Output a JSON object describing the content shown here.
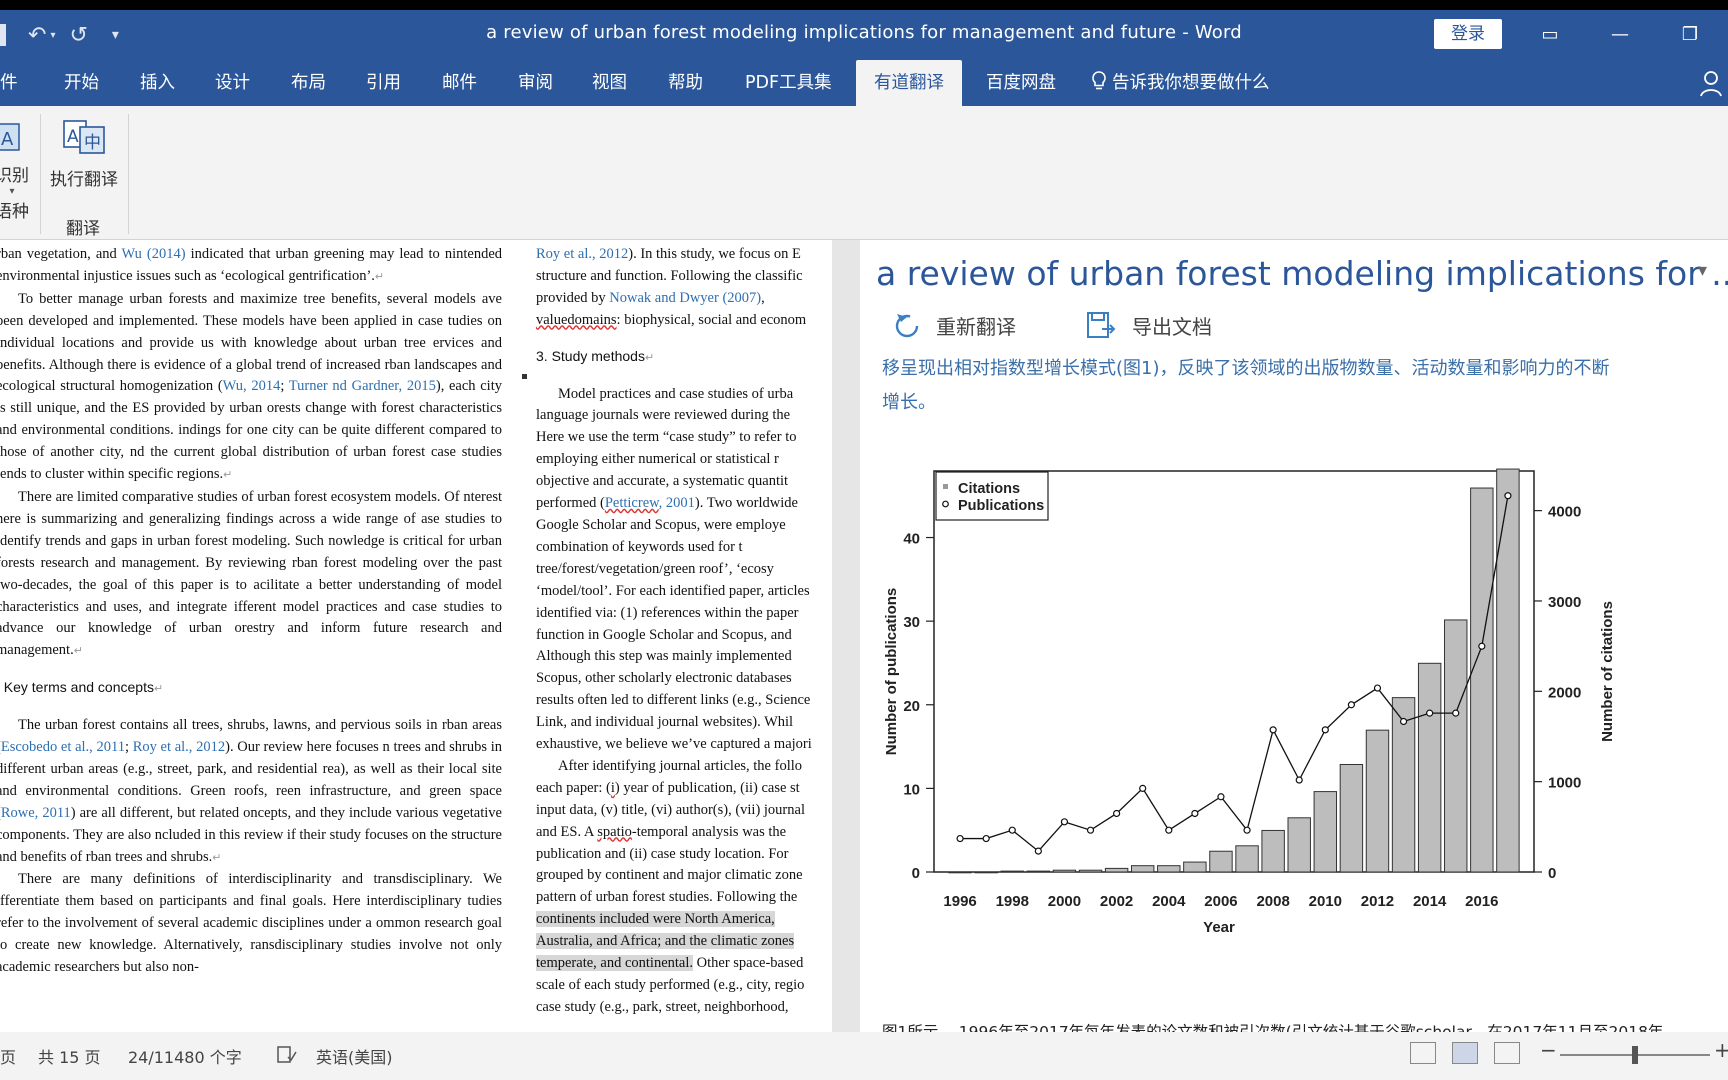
{
  "window": {
    "title": "a review of urban forest modeling implications for management and future  -  Word",
    "login": "登录",
    "restore_glyph": "▭",
    "min_glyph": "—",
    "max_glyph": "❐",
    "undo_glyph": "↶",
    "redo_glyph": "↺",
    "qat_more_glyph": "▾"
  },
  "tabs": [
    {
      "label": "件"
    },
    {
      "label": "开始"
    },
    {
      "label": "插入"
    },
    {
      "label": "设计"
    },
    {
      "label": "布局"
    },
    {
      "label": "引用"
    },
    {
      "label": "邮件"
    },
    {
      "label": "审阅"
    },
    {
      "label": "视图"
    },
    {
      "label": "帮助"
    },
    {
      "label": "PDF工具集"
    },
    {
      "label": "有道翻译"
    },
    {
      "label": "百度网盘"
    }
  ],
  "tellme": "告诉我你想要做什么",
  "ribbon": {
    "btn1_label": "识别",
    "btn1_sub": "语种",
    "btn2_label": "执行翻译",
    "group_label": "翻译",
    "btn2_icon": "A中"
  },
  "doc": {
    "col1": [
      {
        "type": "p0",
        "html": "rban vegetation, and <span class='lnk'>Wu (2014)</span> indicated that urban greening may lead to nintended environmental injustice issues such as ‘ecological gentrification’.<span class='mark'>↵</span>"
      },
      {
        "type": "p",
        "html": "To better manage urban forests and maximize tree benefits, several models ave been developed and implemented. These models have been applied in case tudies on individual locations and provide us with knowledge about urban tree ervices and benefits. Although there is evidence of a global trend of increased rban landscapes and ecological structural homogenization (<span class='lnk'>Wu, 2014</span>; <span class='lnk'>Turner nd Gardner, 2015</span>), each city is still unique, and the ES provided by urban orests change with forest characteristics and environmental conditions. indings for one city can be quite different compared to those of another city, nd the current global distribution of urban forest case studies tends to cluster within specific regions.<span class='mark'>↵</span>"
      },
      {
        "type": "p",
        "html": "There are limited comparative studies of urban forest ecosystem models. Of nterest here is summarizing and generalizing findings across a wide range of ase studies to identify trends and gaps in urban forest modeling. Such nowledge is critical for urban forests research and management. By reviewing rban forest modeling over the past two-decades, the goal of this paper is to acilitate a better understanding of model characteristics and uses, and integrate ifferent model practices and case studies to advance our knowledge of urban orestry and inform future research and management.<span class='mark'>↵</span>"
      },
      {
        "type": "h",
        "html": ". Key terms and concepts<span class='mark'>↵</span>"
      },
      {
        "type": "p",
        "html": "The urban forest contains all trees, shrubs, lawns, and pervious soils in rban areas (<span class='lnk'>Escobedo et al., 2011</span>; <span class='lnk'>Roy et al., 2012</span>). Our review here focuses n trees and shrubs in different urban areas (e.g., street, park, and residential rea), as well as their local site and environmental conditions. Green roofs, reen infrastructure, and green space (<span class='lnk'>Rowe, 2011</span>) are all different, but related oncepts, and they include various vegetative components. They are also ncluded in this review if their study focuses on the structure and benefits of rban trees and shrubs.<span class='mark'>↵</span>"
      },
      {
        "type": "p",
        "html": "There are many definitions of interdisciplinarity and transdisciplinary. We ifferentiate them based on participants and final goals. Here interdisciplinary tudies refer to the involvement of several academic disciplines under a ommon research goal to create new knowledge. Alternatively, ransdisciplinary studies involve not only academic researchers but also non-"
      }
    ],
    "col2": [
      {
        "type": "l",
        "html": "<span class='lnk'>Roy et al., 2012</span>). In this study, we focus on E"
      },
      {
        "type": "l",
        "html": "structure and function. Following the classific"
      },
      {
        "type": "l",
        "html": "provided by <span class='lnk'>Nowak and Dwyer (2007)</span>,"
      },
      {
        "type": "l",
        "html": "<span class='squig'>valuedomains</span>: biophysical, social and econom"
      },
      {
        "type": "h",
        "html": "3. Study methods<span class='mark'>↵</span>"
      },
      {
        "type": "p",
        "html": "Model practices and case studies of urba"
      },
      {
        "type": "l",
        "html": "language journals were reviewed during the"
      },
      {
        "type": "l",
        "html": "Here we use the term “case study” to refer to"
      },
      {
        "type": "l",
        "html": "employing either numerical or statistical r"
      },
      {
        "type": "l",
        "html": "objective and accurate, a systematic quantit"
      },
      {
        "type": "l",
        "html": "performed (<span class='lnk squig'>Petticrew</span><span class='lnk'>, 2001</span>). Two worldwide"
      },
      {
        "type": "l",
        "html": "Google Scholar and Scopus, were employe"
      },
      {
        "type": "l",
        "html": "combination of keywords used for t"
      },
      {
        "type": "l",
        "html": "tree/forest/vegetation/green roof’, ‘ecosy"
      },
      {
        "type": "l",
        "html": "‘model/tool’. For each identified paper, articles"
      },
      {
        "type": "l",
        "html": "identified via: (1) references within the paper"
      },
      {
        "type": "l",
        "html": "function in Google Scholar and Scopus, and"
      },
      {
        "type": "l",
        "html": "Although this step was mainly implemented"
      },
      {
        "type": "l",
        "html": "Scopus, other scholarly electronic databases"
      },
      {
        "type": "l",
        "html": "results often led to different links (e.g., Science"
      },
      {
        "type": "l",
        "html": "Link, and individual journal websites). Whil"
      },
      {
        "type": "l",
        "html": "exhaustive, we believe we’ve captured a majori"
      },
      {
        "type": "p",
        "html": "After identifying journal articles, the follo"
      },
      {
        "type": "l",
        "html": "each paper: (<span class='squig'>i</span>) year of publication, (ii) case st"
      },
      {
        "type": "l",
        "html": "input data, (v) title, (vi) author(s), (vii) journal"
      },
      {
        "type": "l",
        "html": "and ES. A <span class='squig'>spatio</span>-temporal analysis was the"
      },
      {
        "type": "l",
        "html": "publication and (ii) case study location. For"
      },
      {
        "type": "l",
        "html": "grouped by continent and major climatic zone"
      },
      {
        "type": "l",
        "html": "pattern of urban forest studies. Following the"
      },
      {
        "type": "l",
        "html": "<span class='hl'>continents included were North America,</span>"
      },
      {
        "type": "l",
        "html": "<span class='hl'>Australia, and Africa; and the climatic zones</span>"
      },
      {
        "type": "l",
        "html": "<span class='hl'>temperate, and continental.</span> Other space-based"
      },
      {
        "type": "l",
        "html": "scale of each study performed (e.g., city, regio"
      },
      {
        "type": "l",
        "html": "case study (e.g., park, street, neighborhood, "
      }
    ]
  },
  "pane": {
    "title": "a review of urban forest modeling implications for ...",
    "caret": "▾",
    "retranslate": "重新翻译",
    "export": "导出文档",
    "zh_line1": "移呈现出相对指数型增长模式(图1)，反映了该领域的出版物数量、活动数量和影响力的不断",
    "zh_line2": "增长。",
    "caption": "图1所示。 1996年至2017年每年发表的论文数和被引次数(引文统计基于谷歌scholar，在2017年11月至2018年"
  },
  "status": {
    "page": "页",
    "pages": "共 15 页",
    "words": "24/11480 个字",
    "lang": "英语(美国)",
    "zoom_minus": "−",
    "zoom_plus": "+"
  },
  "chart_data": {
    "type": "bar",
    "xlabel": "Year",
    "ylabel": "Number of publications",
    "y2label": "Number of citations",
    "legend": [
      "Citations",
      "Publications"
    ],
    "legend_position": "top-left",
    "categories": [
      1996,
      1997,
      1998,
      1999,
      2000,
      2001,
      2002,
      2003,
      2004,
      2005,
      2006,
      2007,
      2008,
      2009,
      2010,
      2011,
      2012,
      2013,
      2014,
      2015,
      2016,
      2017
    ],
    "xticks": [
      "1996",
      "1998",
      "2000",
      "2002",
      "2004",
      "2006",
      "2008",
      "2010",
      "2012",
      "2014",
      "2016"
    ],
    "yticks": [
      "0",
      "10",
      "20",
      "30",
      "40"
    ],
    "y2ticks": [
      "0",
      "1000",
      "2000",
      "3000",
      "4000"
    ],
    "ylim": [
      0,
      47
    ],
    "y2lim": [
      0,
      4350
    ],
    "series": [
      {
        "name": "Citations",
        "kind": "bar",
        "axis": "right",
        "values": [
          0,
          0,
          10,
          10,
          20,
          20,
          40,
          70,
          70,
          110,
          230,
          290,
          460,
          600,
          890,
          1190,
          1570,
          1930,
          2310,
          2790,
          4250,
          4460
        ],
        "color": "#bdbdbd"
      },
      {
        "name": "Publications",
        "kind": "line",
        "axis": "left",
        "values": [
          4,
          4,
          5,
          2.5,
          6,
          5,
          7,
          10,
          5,
          7,
          9,
          5,
          17,
          11,
          17,
          20,
          22,
          18,
          19,
          19,
          27,
          45
        ],
        "color": "#111111"
      }
    ],
    "grid": false
  }
}
